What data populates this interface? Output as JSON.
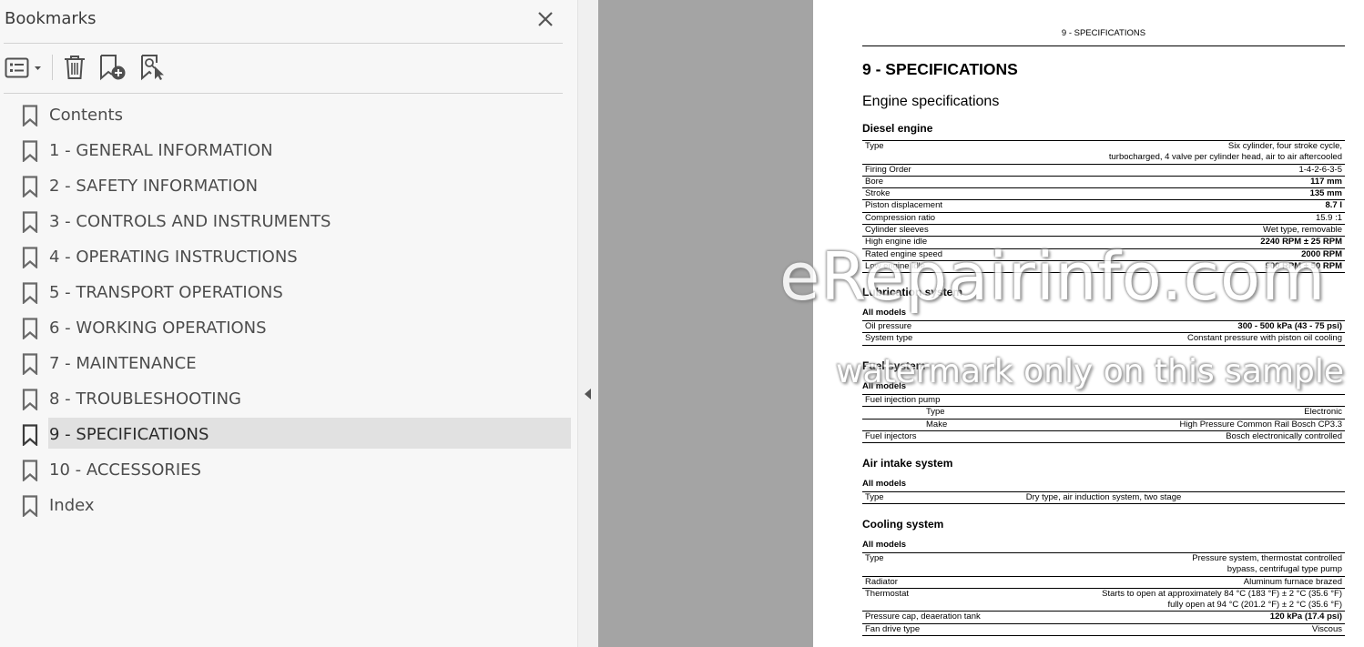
{
  "bookmarks_panel": {
    "title": "Bookmarks",
    "items": [
      {
        "label": "Contents"
      },
      {
        "label": "1 - GENERAL INFORMATION"
      },
      {
        "label": "2 - SAFETY INFORMATION"
      },
      {
        "label": "3 - CONTROLS AND INSTRUMENTS"
      },
      {
        "label": "4 - OPERATING INSTRUCTIONS"
      },
      {
        "label": "5 - TRANSPORT OPERATIONS"
      },
      {
        "label": "6 - WORKING OPERATIONS"
      },
      {
        "label": "7 - MAINTENANCE"
      },
      {
        "label": "8 - TROUBLESHOOTING"
      },
      {
        "label": "9 - SPECIFICATIONS",
        "selected": true
      },
      {
        "label": "10 - ACCESSORIES"
      },
      {
        "label": "Index"
      }
    ]
  },
  "icons": {
    "close": "close-icon",
    "options": "list-options-icon",
    "delete": "trash-icon",
    "add": "add-bookmark-icon",
    "find": "find-bookmark-icon",
    "bookmark": "bookmark-icon",
    "collapse": "collapse-arrow-icon"
  },
  "colors": {
    "panel_bg": "#f7f7f7",
    "selected_bg": "#e1e1e1",
    "viewer_gray": "#a4a4a4"
  },
  "document": {
    "running_header": "9 - SPECIFICATIONS",
    "heading": "9 - SPECIFICATIONS",
    "subheading": "Engine specifications",
    "diesel": {
      "title": "Diesel engine",
      "rows": [
        {
          "k": "Type",
          "v": "Six cylinder, four stroke cycle,\nturbocharged, 4 valve per cylinder head, air to air aftercooled"
        },
        {
          "k": "Firing Order",
          "v": "1-4-2-6-3-5"
        },
        {
          "k": "Bore",
          "v": "117 mm"
        },
        {
          "k": "Stroke",
          "v": "135 mm"
        },
        {
          "k": "Piston displacement",
          "v": "8.7 l"
        },
        {
          "k": "Compression ratio",
          "v": "15.9 :1"
        },
        {
          "k": "Cylinder sleeves",
          "v": "Wet type, removable"
        },
        {
          "k": "High engine idle",
          "v": "2240 RPM ± 25 RPM"
        },
        {
          "k": "Rated engine speed",
          "v": "2000 RPM"
        },
        {
          "k": "Low engine idle",
          "v": "900 RPM ± 50 RPM"
        }
      ]
    },
    "lubrication": {
      "title": "Lubrication system",
      "models": "All models",
      "rows": [
        {
          "k": "Oil pressure",
          "v": "300 - 500 kPa (43 - 75 psi)"
        },
        {
          "k": "System type",
          "v": "Constant pressure with piston oil cooling"
        }
      ]
    },
    "fuel": {
      "title": "Fuel system",
      "models": "All models",
      "rows": [
        {
          "k": "Fuel injection pump",
          "v": ""
        },
        {
          "k": "Type",
          "v": "Electronic"
        },
        {
          "k": "Make",
          "v": "High Pressure Common Rail Bosch CP3.3"
        },
        {
          "k": "Fuel injectors",
          "v": "Bosch electronically controlled"
        }
      ]
    },
    "air": {
      "title": "Air intake system",
      "models": "All models",
      "rows": [
        {
          "k": "Type",
          "v": "Dry type, air induction system, two stage"
        }
      ]
    },
    "cooling": {
      "title": "Cooling system",
      "models": "All models",
      "rows": [
        {
          "k": "Type",
          "v": "Pressure system, thermostat controlled\nbypass, centrifugal type pump"
        },
        {
          "k": "Radiator",
          "v": "Aluminum furnace brazed"
        },
        {
          "k": "Thermostat",
          "v": "Starts to open at approximately 84 °C (183 °F) ± 2 °C (35.6 °F)\nfully open at 94 °C (201.2 °F) ± 2 °C (35.6 °F)"
        },
        {
          "k": "Pressure cap, deaeration tank",
          "v": "120 kPa (17.4 psi)"
        },
        {
          "k": "Fan drive type",
          "v": "Viscous"
        }
      ]
    }
  },
  "watermark": {
    "main": "eRepairinfo.com",
    "sub": "watermark only on this sample"
  }
}
